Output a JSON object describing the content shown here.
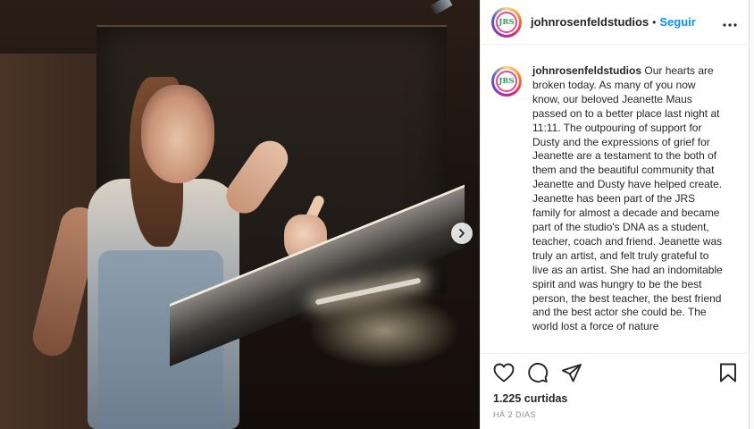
{
  "post": {
    "username": "johnrosenfeldstudios",
    "follow_label": "Seguir",
    "separator": "•",
    "avatar_text": "JRS",
    "more_label": "•••",
    "caption_username": "johnrosenfeldstudios",
    "caption_text": "Our hearts are broken today. As many of you now know, our beloved Jeanette Maus passed on to a better place last night at 11:11. The outpouring of support for Dusty and the expressions of grief for Jeanette are a testament to the both of them and the beautiful community that Jeanette and Dusty have helped create. Jeanette has been part of the JRS family for almost a decade and became part of the studio's DNA as a student, teacher, coach and friend.  Jeanette was truly an artist, and felt truly grateful to live as an artist. She had an indomitable spirit and was hungry to be the best person, the best teacher, the best friend and the best actor she could be. The world lost a force of nature",
    "likes": "1.225 curtidas",
    "time_ago": "HÁ 2 DIAS"
  },
  "icons": {
    "like": "heart-icon",
    "comment": "comment-icon",
    "share": "share-icon",
    "save": "bookmark-icon",
    "next": "chevron-right-icon",
    "more": "more-icon"
  },
  "colors": {
    "accent": "#0095f6",
    "text": "#262626",
    "muted": "#8e8e8e"
  }
}
